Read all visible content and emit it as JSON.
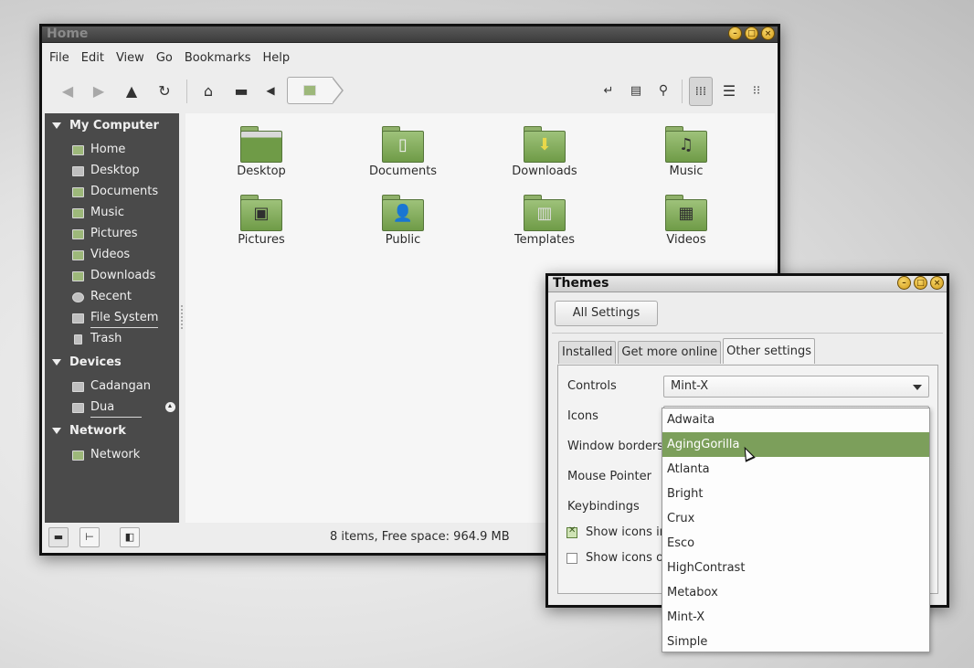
{
  "file_manager": {
    "title": "Home",
    "menu": [
      "File",
      "Edit",
      "View",
      "Go",
      "Bookmarks",
      "Help"
    ],
    "sidebar": {
      "my_computer": {
        "header": "My Computer",
        "items": [
          "Home",
          "Desktop",
          "Documents",
          "Music",
          "Pictures",
          "Videos",
          "Downloads",
          "Recent",
          "File System",
          "Trash"
        ]
      },
      "devices": {
        "header": "Devices",
        "items": [
          "Cadangan",
          "Dua"
        ]
      },
      "network": {
        "header": "Network",
        "items": [
          "Network"
        ]
      }
    },
    "files": [
      {
        "name": "Desktop",
        "icon": "desktop-folder-icon"
      },
      {
        "name": "Documents",
        "icon": "documents-folder-icon"
      },
      {
        "name": "Downloads",
        "icon": "downloads-folder-icon"
      },
      {
        "name": "Music",
        "icon": "music-folder-icon"
      },
      {
        "name": "Pictures",
        "icon": "pictures-folder-icon"
      },
      {
        "name": "Public",
        "icon": "public-folder-icon"
      },
      {
        "name": "Templates",
        "icon": "templates-folder-icon"
      },
      {
        "name": "Videos",
        "icon": "videos-folder-icon"
      }
    ],
    "status": "8 items, Free space: 964.9 MB"
  },
  "themes": {
    "title": "Themes",
    "all_settings": "All Settings",
    "tabs": [
      "Installed",
      "Get more online",
      "Other settings"
    ],
    "active_tab": "Other settings",
    "rows": {
      "controls_label": "Controls",
      "controls_value": "Mint-X",
      "icons_label": "Icons",
      "window_borders_label": "Window borders",
      "mouse_pointer_label": "Mouse Pointer",
      "keybindings_label": "Keybindings"
    },
    "checkboxes": [
      {
        "label": "Show icons in",
        "checked": true
      },
      {
        "label": "Show icons on",
        "checked": false
      }
    ],
    "dropdown": {
      "options": [
        "Adwaita",
        "AgingGorilla",
        "Atlanta",
        "Bright",
        "Crux",
        "Esco",
        "HighContrast",
        "Metabox",
        "Mint-X",
        "Simple"
      ],
      "highlighted": "AgingGorilla"
    }
  },
  "colors": {
    "accent_green": "#7c9f5b",
    "sidebar_bg": "#4a4a4a"
  }
}
